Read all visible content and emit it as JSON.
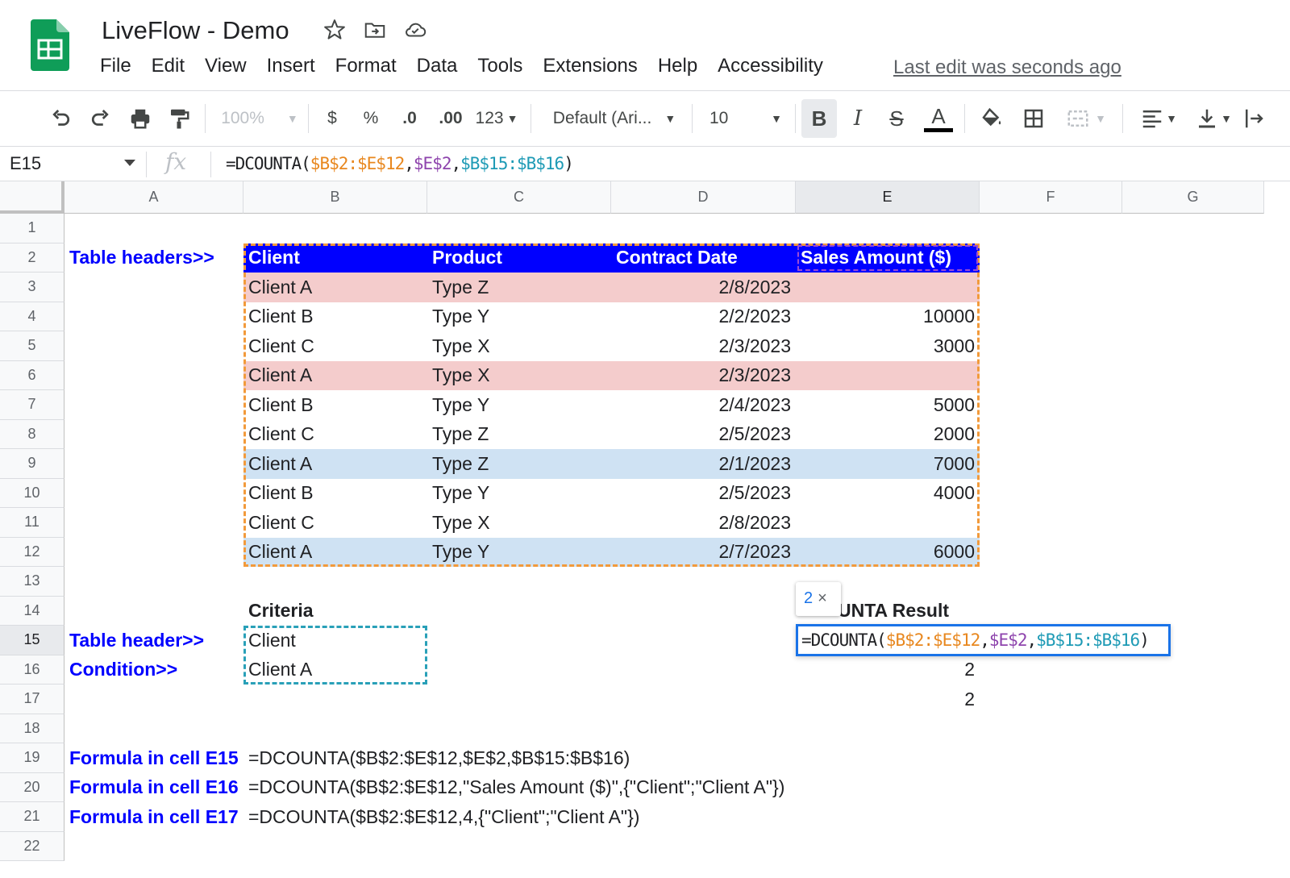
{
  "app": {
    "title": "LiveFlow - Demo",
    "last_edit": "Last edit was seconds ago",
    "menu": [
      "File",
      "Edit",
      "View",
      "Insert",
      "Format",
      "Data",
      "Tools",
      "Extensions",
      "Help",
      "Accessibility"
    ]
  },
  "toolbar": {
    "zoom": "100%",
    "currency": "$",
    "percent": "%",
    "decrease_decimals": ".0",
    "increase_decimals": ".00",
    "number_format": "123",
    "font": "Default (Ari...",
    "font_size": "10",
    "bold": "B",
    "italic": "I",
    "strikethrough": "S",
    "text_color": "A"
  },
  "formula_bar": {
    "name_box": "E15",
    "fx": "fx",
    "parts": [
      "=DCOUNTA(",
      "$B$2:$E$12",
      ",",
      "$E$2",
      ",",
      "$B$15:$B$16",
      ")"
    ]
  },
  "columns": [
    "A",
    "B",
    "C",
    "D",
    "E",
    "F",
    "G"
  ],
  "rows": [
    "1",
    "2",
    "3",
    "4",
    "5",
    "6",
    "7",
    "8",
    "9",
    "10",
    "11",
    "12",
    "13",
    "14",
    "15",
    "16",
    "17",
    "18",
    "19",
    "20",
    "21",
    "22"
  ],
  "labels": {
    "table_headers": "Table headers>>",
    "table_header": "Table header>>",
    "condition": "Condition>>",
    "criteria": "Criteria",
    "result_title": "UNTA Result",
    "formula_e15": "Formula in cell E15",
    "formula_e16": "Formula in cell E16",
    "formula_e17": "Formula in cell E17"
  },
  "table": {
    "headers": [
      "Client",
      "Product",
      "Contract Date",
      "Sales Amount ($)"
    ],
    "rows": [
      [
        "Client A",
        "Type Z",
        "2/8/2023",
        ""
      ],
      [
        "Client B",
        "Type Y",
        "2/2/2023",
        "10000"
      ],
      [
        "Client C",
        "Type X",
        "2/3/2023",
        "3000"
      ],
      [
        "Client A",
        "Type X",
        "2/3/2023",
        ""
      ],
      [
        "Client B",
        "Type Y",
        "2/4/2023",
        "5000"
      ],
      [
        "Client C",
        "Type Z",
        "2/5/2023",
        "2000"
      ],
      [
        "Client A",
        "Type Z",
        "2/1/2023",
        "7000"
      ],
      [
        "Client B",
        "Type Y",
        "2/5/2023",
        "4000"
      ],
      [
        "Client C",
        "Type X",
        "2/8/2023",
        ""
      ],
      [
        "Client A",
        "Type Y",
        "2/7/2023",
        "6000"
      ]
    ]
  },
  "criteria": {
    "header": "Client",
    "value": "Client A"
  },
  "results": {
    "e16": "2",
    "e17": "2"
  },
  "tooltip": {
    "count": "2",
    "close": "×"
  },
  "formulas": {
    "e15": "=DCOUNTA($B$2:$E$12,$E$2,$B$15:$B$16)",
    "e16": "=DCOUNTA($B$2:$E$12,\"Sales Amount ($)\",{\"Client\";\"Client A\"})",
    "e17": "=DCOUNTA($B$2:$E$12,4,{\"Client\";\"Client A\"})"
  },
  "colors": {
    "header_bg": "#0000ff",
    "pink_band": "#f4cccc",
    "blue_band": "#cfe2f3",
    "label_blue": "#0000ff",
    "range_orange": "#f29a3b",
    "range_purple": "#9a4cd6",
    "range_teal": "#29a0b8",
    "selection_blue": "#1a73e8"
  }
}
